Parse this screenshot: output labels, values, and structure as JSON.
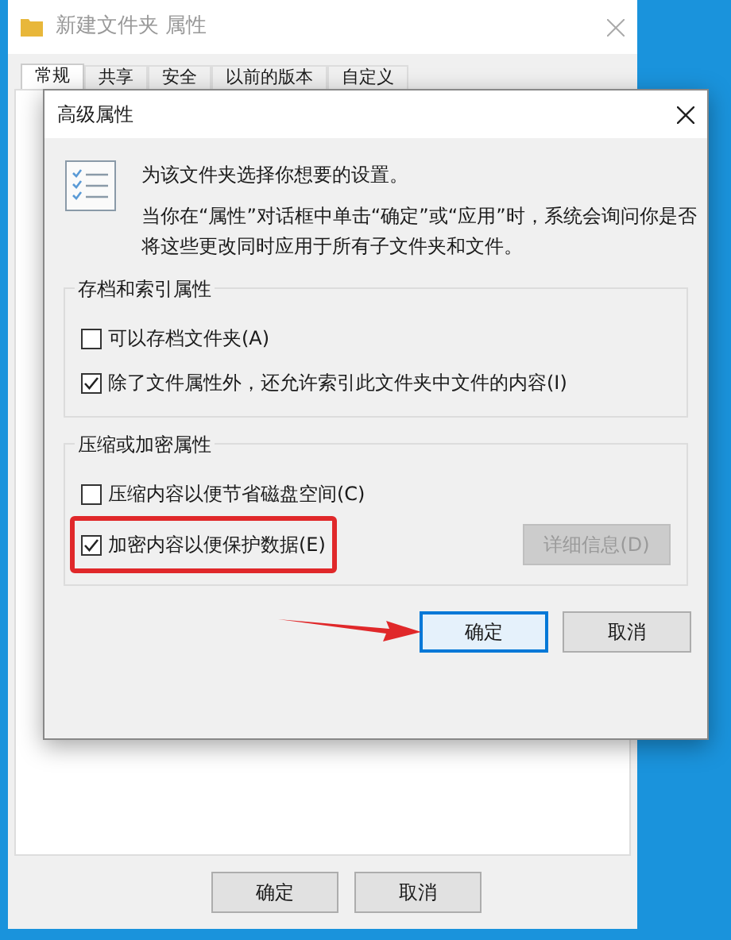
{
  "background_window": {
    "title": "新建文件夹 属性",
    "tabs": [
      {
        "label": "常规",
        "selected": true
      },
      {
        "label": "共享",
        "selected": false
      },
      {
        "label": "安全",
        "selected": false
      },
      {
        "label": "以前的版本",
        "selected": false
      },
      {
        "label": "自定义",
        "selected": false
      }
    ],
    "buttons": [
      {
        "label": "确定"
      },
      {
        "label": "取消"
      }
    ]
  },
  "dialog": {
    "title": "高级属性",
    "intro": "为该文件夹选择你想要的设置。",
    "note": "当你在“属性”对话框中单击“确定”或“应用”时，系统会询问你是否将这些更改同时应用于所有子文件夹和文件。",
    "groups": [
      {
        "title": "存档和索引属性",
        "options": [
          {
            "label": "可以存档文件夹(A)",
            "checked": false,
            "highlighted": false
          },
          {
            "label": "除了文件属性外，还允许索引此文件夹中文件的内容(I)",
            "checked": true,
            "highlighted": false
          }
        ]
      },
      {
        "title": "压缩或加密属性",
        "options": [
          {
            "label": "压缩内容以便节省磁盘空间(C)",
            "checked": false,
            "highlighted": false
          },
          {
            "label": "加密内容以便保护数据(E)",
            "checked": true,
            "highlighted": true
          }
        ],
        "button": {
          "label": "详细信息(D)",
          "disabled": true
        }
      }
    ],
    "buttons": [
      {
        "label": "确定",
        "focused": true,
        "pointed": true
      },
      {
        "label": "取消",
        "focused": false,
        "pointed": false
      }
    ]
  }
}
